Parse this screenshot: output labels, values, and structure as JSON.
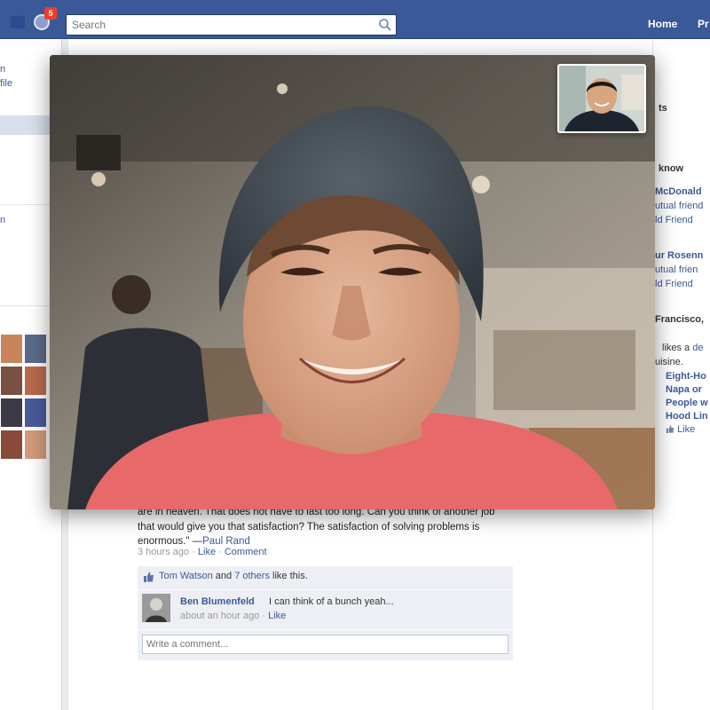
{
  "header": {
    "notification_count": "5",
    "search_placeholder": "Search",
    "nav_home": "Home",
    "nav_profile_fragment": "Pr"
  },
  "left_column": {
    "fragment_1": "n",
    "fragment_2": "file",
    "fragment_3": "n"
  },
  "right_column": {
    "fragment_ts": "ts",
    "fragment_know": "know",
    "person_1_name": "McDonald",
    "person_1_mutual": "utual friend",
    "person_1_action": "ld Friend",
    "person_2_name": "ur Rosenn",
    "person_2_mutual": "utual frien",
    "person_2_action": "ld Friend",
    "location": "Francisco,",
    "likes_fragment": "likes a",
    "likes_link_fragment": "de",
    "cuisine_fragment": "uisine.",
    "event_line_1": "Eight-Ho",
    "event_line_2": "Napa or",
    "event_line_3": "People w",
    "event_line_4": "Hood Lin",
    "like_label": "Like"
  },
  "post": {
    "quote_text": "\"When you solve a [design] problem, you think you are in heaven. You might change your mind later on, but you have already had the opportunity to think you are in heaven. That does not have to last too long. Can you think of another job that would give you that satisfaction? The satisfaction of solving problems is enormous.\" —",
    "quote_author": "Paul Rand",
    "time": "3 hours ago",
    "sep": " · ",
    "like_action": "Like",
    "comment_action": "Comment",
    "liker": "Tom Watson",
    "likes_and": " and ",
    "likes_others": "7 others",
    "likes_suffix": " like this."
  },
  "comment": {
    "author": "Ben Blumenfeld",
    "text": "I can think of a bunch yeah...",
    "time": "about an hour ago",
    "sep": " · ",
    "like_action": "Like"
  },
  "composer": {
    "placeholder": "Write a comment..."
  },
  "colors": {
    "brand_blue": "#3b5998",
    "link_blue": "#3b5998",
    "notification_red": "#f03d25",
    "page_bg": "#e9ebee",
    "shirt_red": "#e8696a"
  },
  "icons": {
    "search": "search-icon",
    "friends": "friends-icon",
    "globe": "globe-icon",
    "thumb": "thumbs-up-icon"
  }
}
